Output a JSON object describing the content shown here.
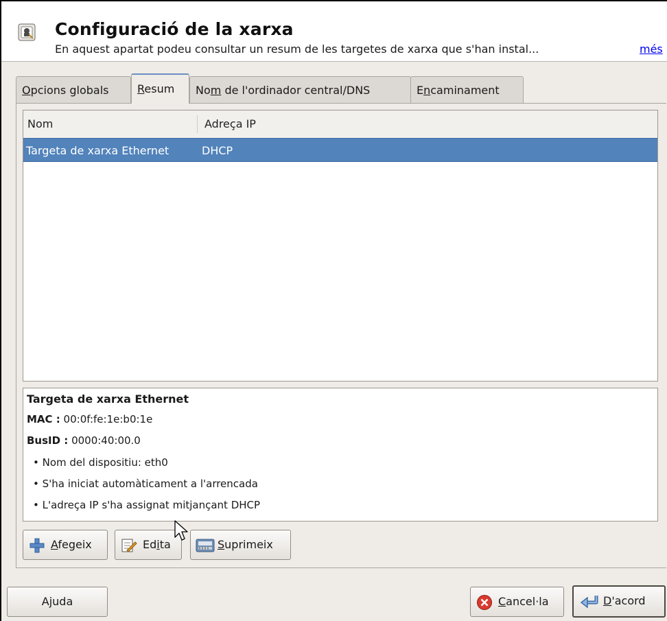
{
  "header": {
    "title": "Configuració de la xarxa",
    "subtitle": "En aquest apartat podeu consultar un resum de les targetes de xarxa que s'han instal...",
    "more_link": "més",
    "icon": "network-settings-icon"
  },
  "tabs": [
    {
      "label_pre": "",
      "label_u": "O",
      "label_post": "pcions globals",
      "active": false
    },
    {
      "label_pre": "",
      "label_u": "R",
      "label_post": "esum",
      "active": true
    },
    {
      "label_pre": "No",
      "label_u": "m",
      "label_post": " de l'ordinador central/DNS",
      "active": false
    },
    {
      "label_pre": "E",
      "label_u": "n",
      "label_post": "caminament",
      "active": false
    }
  ],
  "table": {
    "columns": [
      "Nom",
      "Adreça IP"
    ],
    "rows": [
      {
        "name": "Targeta de xarxa Ethernet",
        "ip": "DHCP",
        "selected": true
      }
    ]
  },
  "details": {
    "title": "Targeta de xarxa Ethernet",
    "mac_label": "MAC :",
    "mac_value": "00:0f:fe:1e:b0:1e",
    "busid_label": "BusID :",
    "busid_value": "0000:40:00.0",
    "bullets": [
      "• Nom del dispositiu: eth0",
      "• S'ha iniciat automàticament a l'arrencada",
      "• L'adreça IP s'ha assignat mitjançant DHCP"
    ]
  },
  "actions": {
    "add": {
      "pre": "",
      "u": "A",
      "post": "fegeix",
      "icon": "plus-icon"
    },
    "edit": {
      "pre": "Ed",
      "u": "i",
      "post": "ta",
      "icon": "edit-pencil-icon"
    },
    "delete": {
      "pre": "",
      "u": "S",
      "post": "uprimeix",
      "icon": "delete-device-icon"
    }
  },
  "dialog_buttons": {
    "help": "Ajuda",
    "cancel": {
      "pre": "",
      "u": "C",
      "post": "ancel·la",
      "icon": "cancel-red-icon"
    },
    "ok": {
      "pre": "",
      "u": "D",
      "post": "'acord",
      "icon": "ok-enter-arrow-icon"
    }
  },
  "colors": {
    "selection": "#5283bb",
    "background": "#efebe7",
    "link": "#0000ee",
    "active_tab_accent": "#6a8fc2"
  }
}
